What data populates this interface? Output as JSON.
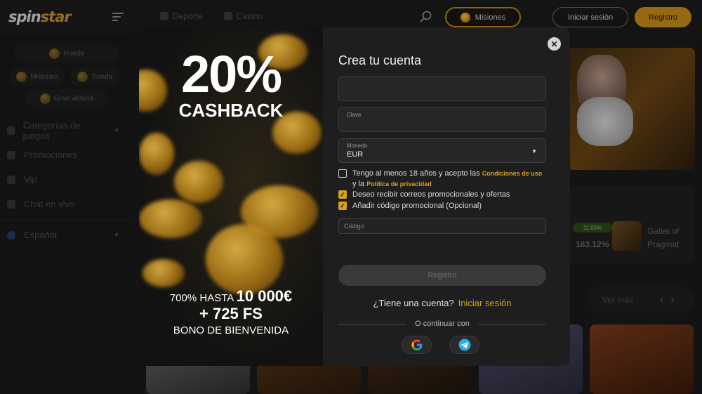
{
  "header": {
    "logo_text_a": "spin",
    "logo_text_b": "star",
    "nav": [
      {
        "label": "Deporte",
        "icon": "soccer-ball-icon"
      },
      {
        "label": "Casino",
        "icon": "slot-machine-icon"
      }
    ],
    "misiones_label": "Misiones",
    "login_label": "Iniciar sesión",
    "register_label": "Registro"
  },
  "sidebar": {
    "pills": [
      {
        "label": "Rueda",
        "icon": "wheel-icon"
      },
      {
        "label": "Misiones",
        "icon": "coin-icon"
      },
      {
        "label": "Tienda",
        "icon": "chest-icon"
      },
      {
        "label": "Gran victoria",
        "icon": "trophy-icon"
      }
    ],
    "menu": [
      {
        "label": "Categorías de juegos",
        "icon": "grid-icon"
      },
      {
        "label": "Promociones",
        "icon": "badge-icon"
      },
      {
        "label": "Vip",
        "icon": "diamond-icon"
      },
      {
        "label": "Chat en vivo",
        "icon": "chat-icon"
      },
      {
        "label": "Español",
        "icon": "globe-icon"
      }
    ]
  },
  "background": {
    "badge": "11.05%",
    "percent": "163.12%",
    "game_name_line1": "Gates of",
    "game_name_line2": "Pragmat",
    "ver_mas": "Ver más"
  },
  "promo": {
    "big": "20%",
    "sub": "CASHBACK",
    "line1_prefix": "700% HASTA",
    "line1_amount": "10 000€",
    "line2": "+ 725 FS",
    "line3": "BONO DE BIENVENIDA"
  },
  "form": {
    "title": "Crea tu cuenta",
    "email_value": "",
    "password_label": "Clave",
    "password_value": "",
    "currency_label": "Moneda",
    "currency_value": "EUR",
    "terms_text_a": "Tengo al menos 18 años y acepto las",
    "terms_link": "Condiciones de uso",
    "terms_text_b": "y la",
    "privacy_link": "Política de privacidad",
    "promo_emails": "Deseo recibir correos promocionales y ofertas",
    "promo_code_toggle": "Añadir código promocional (Opcional)",
    "code_placeholder": "Código",
    "register_button": "Registro",
    "have_account": "¿Tiene una cuenta?",
    "login_link": "Iniciar sesión",
    "or_continue": "O continuar con",
    "checkboxes": {
      "terms": false,
      "emails": true,
      "code": true
    }
  },
  "colors": {
    "accent": "#c98e18",
    "accent_text": "#d9a020",
    "google_blue": "#4285F4",
    "telegram_blue": "#2AABEE"
  }
}
